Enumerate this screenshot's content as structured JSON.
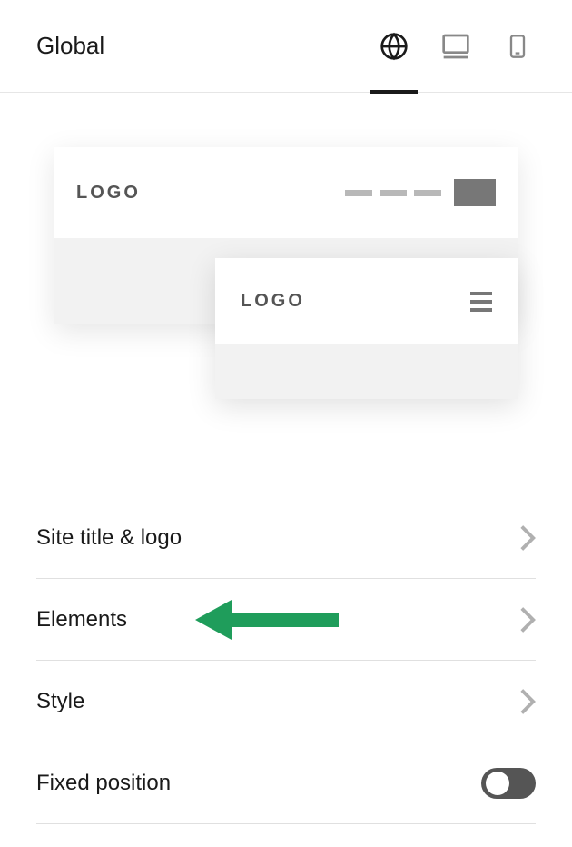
{
  "header": {
    "title": "Global"
  },
  "preview": {
    "desktop_logo": "LOGO",
    "mobile_logo": "LOGO"
  },
  "settings": {
    "items": [
      {
        "label": "Site title & logo",
        "type": "nav"
      },
      {
        "label": "Elements",
        "type": "nav"
      },
      {
        "label": "Style",
        "type": "nav"
      },
      {
        "label": "Fixed position",
        "type": "toggle"
      }
    ]
  }
}
